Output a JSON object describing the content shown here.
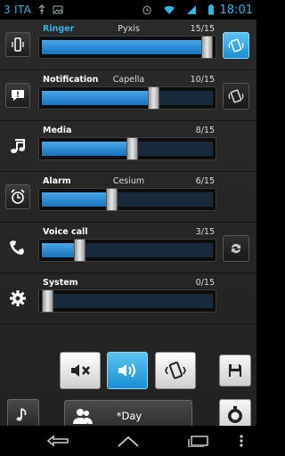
{
  "status_bar": {
    "carrier": "3 ITA",
    "time": "18:01",
    "icons": [
      "usb-icon",
      "photo-icon",
      "alarm-icon",
      "wifi-icon",
      "signal-icon",
      "battery-icon"
    ]
  },
  "streams": [
    {
      "name": "Ringer",
      "tone": "Pyxis",
      "count": "15/15",
      "level": 1.0,
      "left_icon": "ringer-icon",
      "right_icon": "vibrate-icon",
      "active": true
    },
    {
      "name": "Notification",
      "tone": "Capella",
      "count": "10/15",
      "level": 0.667,
      "left_icon": "notification-icon",
      "right_icon": "vibrate-icon"
    },
    {
      "name": "Media",
      "tone": "",
      "count": "8/15",
      "level": 0.533,
      "left_icon": "music-note-icon"
    },
    {
      "name": "Alarm",
      "tone": "Cesium",
      "count": "6/15",
      "level": 0.4,
      "left_icon": "alarm-clock-icon"
    },
    {
      "name": "Voice call",
      "tone": "",
      "count": "3/15",
      "level": 0.2,
      "left_icon": "phone-icon",
      "right_icon": "sync-icon"
    },
    {
      "name": "System",
      "tone": "",
      "count": "0/15",
      "level": 0.0,
      "left_icon": "gear-icon"
    }
  ],
  "modes": {
    "silent_icon": "mute-icon",
    "sound_icon": "speaker-icon",
    "vibrate_icon": "vibrate-icon",
    "selected": "sound"
  },
  "profile": {
    "label": "*Day",
    "icon": "people-icon"
  },
  "colors": {
    "accent": "#33b5e5",
    "fill": "#2a8fd8"
  }
}
